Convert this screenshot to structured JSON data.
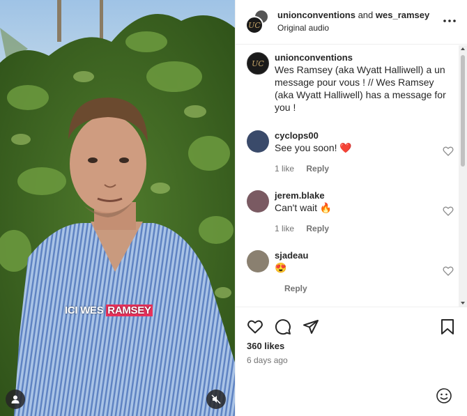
{
  "video": {
    "caption_plain": "ICI WES",
    "caption_highlight": "RAMSEY"
  },
  "header": {
    "user1": "unionconventions",
    "joiner": "and",
    "user2": "wes_ramsey",
    "audio": "Original audio",
    "avatar_text": "UC"
  },
  "post": {
    "author": "unionconventions",
    "avatar_text": "UC",
    "text": "Wes Ramsey (aka Wyatt Halliwell) a un message pour vous ! // Wes Ramsey (aka Wyatt Halliwell) has a message for you !"
  },
  "comments": [
    {
      "user": "cyclops00",
      "text": "See you soon!",
      "emoji": "❤️",
      "likes": "1 like",
      "reply": "Reply"
    },
    {
      "user": "jerem.blake",
      "text": "Can't wait",
      "emoji": "🔥",
      "likes": "1 like",
      "reply": "Reply"
    },
    {
      "user": "sjadeau",
      "text": "",
      "emoji": "😍",
      "likes": "",
      "reply": "Reply"
    }
  ],
  "stats": {
    "likes": "360 likes",
    "time_ago": "6 days ago"
  },
  "icons": [
    "user-icon",
    "mute-icon",
    "more-options-icon",
    "like-icon",
    "comment-icon",
    "share-icon",
    "bookmark-icon",
    "emoji-icon"
  ]
}
